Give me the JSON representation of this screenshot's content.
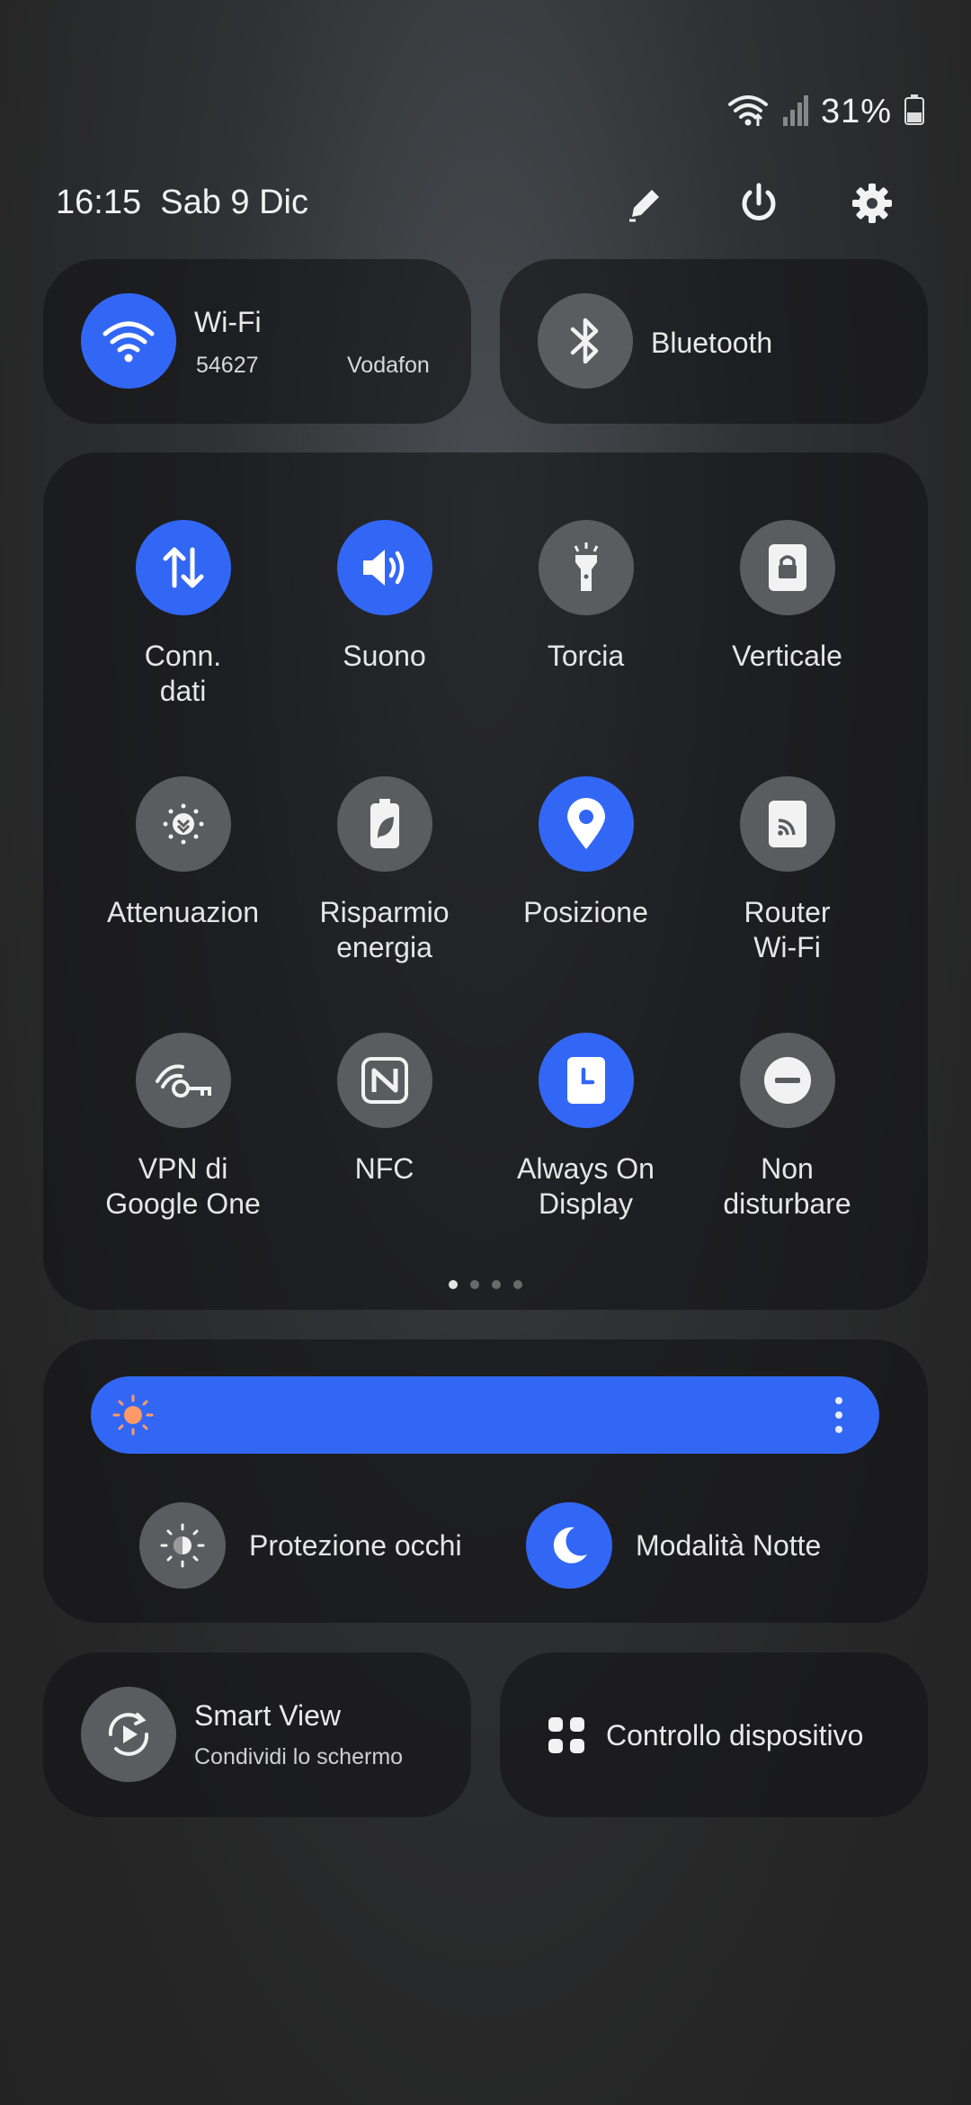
{
  "status_bar": {
    "battery": "31%"
  },
  "header": {
    "time": "16:15",
    "date": "Sab 9 Dic"
  },
  "wifi": {
    "title": "Wi-Fi",
    "ssid_part": "54627",
    "network": "Vodafon"
  },
  "bluetooth": {
    "title": "Bluetooth"
  },
  "tiles": [
    {
      "label": "Conn.\ndati"
    },
    {
      "label": "Suono"
    },
    {
      "label": "Torcia"
    },
    {
      "label": "Verticale"
    },
    {
      "label": "Attenuazion"
    },
    {
      "label": "Risparmio\nenergia"
    },
    {
      "label": "Posizione"
    },
    {
      "label": "Router\nWi-Fi"
    },
    {
      "label": "VPN di\nGoogle One"
    },
    {
      "label": "NFC"
    },
    {
      "label": "Always On\nDisplay"
    },
    {
      "label": "Non\ndisturbare"
    }
  ],
  "pager": {
    "pages": 4,
    "active": 1
  },
  "brightness": {
    "accent": "#3267f6",
    "sun_color": "#ff9a66"
  },
  "eye_protection": {
    "label": "Protezione occhi"
  },
  "night_mode": {
    "label": "Modalità Notte"
  },
  "smart_view": {
    "title": "Smart View",
    "subtitle": "Condividi lo schermo"
  },
  "device_control": {
    "label": "Controllo dispositivo"
  }
}
